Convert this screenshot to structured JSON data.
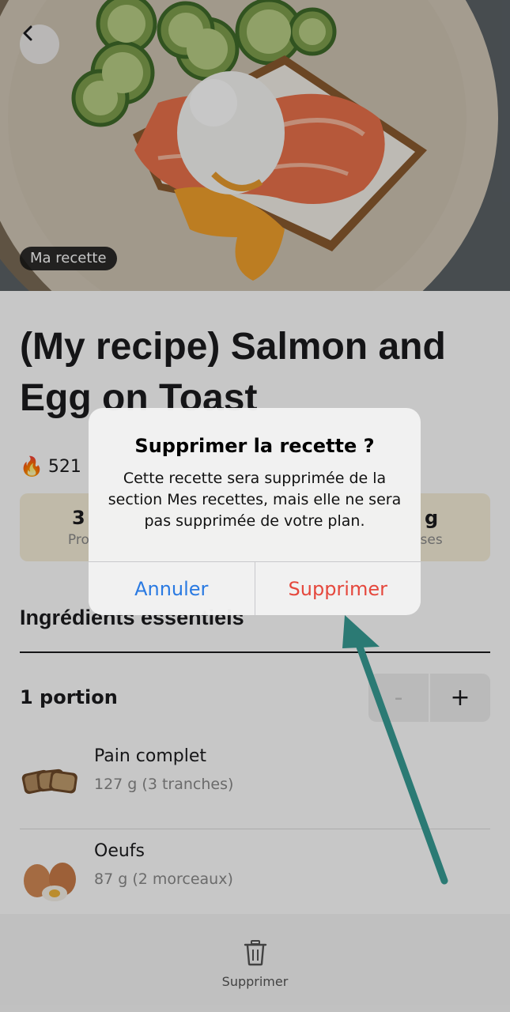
{
  "hero": {
    "tag_label": "Ma recette"
  },
  "recipe": {
    "title": "(My recipe) Salmon and Egg on Toast",
    "calories_fragment": "521",
    "macros": [
      {
        "value": "3",
        "label": "Pro"
      },
      {
        "value": "g",
        "label": "ses"
      }
    ]
  },
  "ingredients": {
    "section_title": "Ingrédients essentiels",
    "portion_label": "1 portion",
    "stepper": {
      "minus": "-",
      "plus": "+"
    },
    "items": [
      {
        "name": "Pain complet",
        "amount": "127 g (3 tranches)",
        "icon": "bread-slices"
      },
      {
        "name": "Oeufs",
        "amount": "87 g (2 morceaux)",
        "icon": "eggs"
      }
    ]
  },
  "bottom_bar": {
    "delete_label": "Supprimer",
    "icon": "trash-icon"
  },
  "alert": {
    "title": "Supprimer la recette ?",
    "message": "Cette recette sera supprimée de la section Mes recettes, mais elle ne sera pas supprimée de votre plan.",
    "cancel_label": "Annuler",
    "confirm_label": "Supprimer"
  },
  "colors": {
    "cancel": "#2a7ae2",
    "destructive": "#e5483d",
    "annotation_arrow": "#2b7a74",
    "macro_card": "#f6efd9"
  }
}
